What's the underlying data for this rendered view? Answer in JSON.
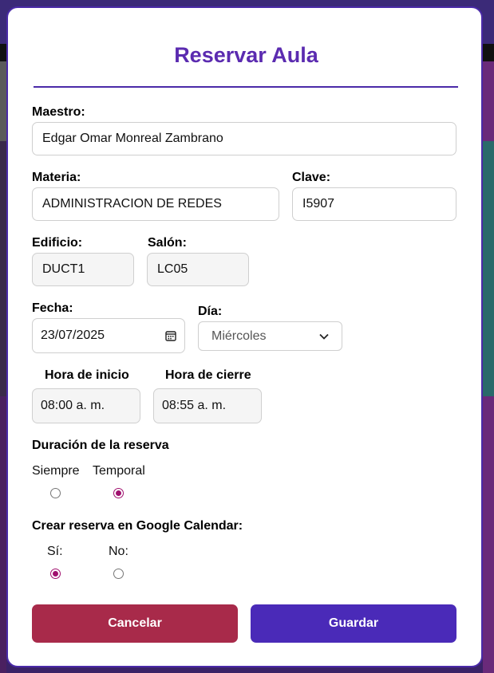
{
  "modal": {
    "title": "Reservar Aula"
  },
  "form": {
    "maestro": {
      "label": "Maestro:",
      "value": "Edgar Omar Monreal Zambrano"
    },
    "materia": {
      "label": "Materia:",
      "value": "ADMINISTRACION DE REDES"
    },
    "clave": {
      "label": "Clave:",
      "value": "I5907"
    },
    "edificio": {
      "label": "Edificio:",
      "value": "DUCT1"
    },
    "salon": {
      "label": "Salón:",
      "value": "LC05"
    },
    "fecha": {
      "label": "Fecha:",
      "value": "23/07/2025",
      "icon": "calendar-icon"
    },
    "dia": {
      "label": "Día:",
      "value": "Miércoles",
      "icon": "chevron-down-icon"
    },
    "hora_inicio": {
      "label": "Hora de inicio",
      "value": "08:00 a. m."
    },
    "hora_cierre": {
      "label": "Hora de cierre",
      "value": "08:55 a. m."
    },
    "duracion": {
      "label": "Duración de la reserva",
      "options": [
        {
          "label": "Siempre",
          "checked": false
        },
        {
          "label": "Temporal",
          "checked": true
        }
      ]
    },
    "google": {
      "label": "Crear reserva en Google Calendar:",
      "options": [
        {
          "label": "Sí:",
          "checked": true
        },
        {
          "label": "No:",
          "checked": false
        }
      ]
    }
  },
  "actions": {
    "cancel_label": "Cancelar",
    "save_label": "Guardar"
  },
  "colors": {
    "accent": "#5b2bb0",
    "cancel": "#a82a4a",
    "save": "#4a2ab8",
    "radio_checked": "#a0106e"
  }
}
